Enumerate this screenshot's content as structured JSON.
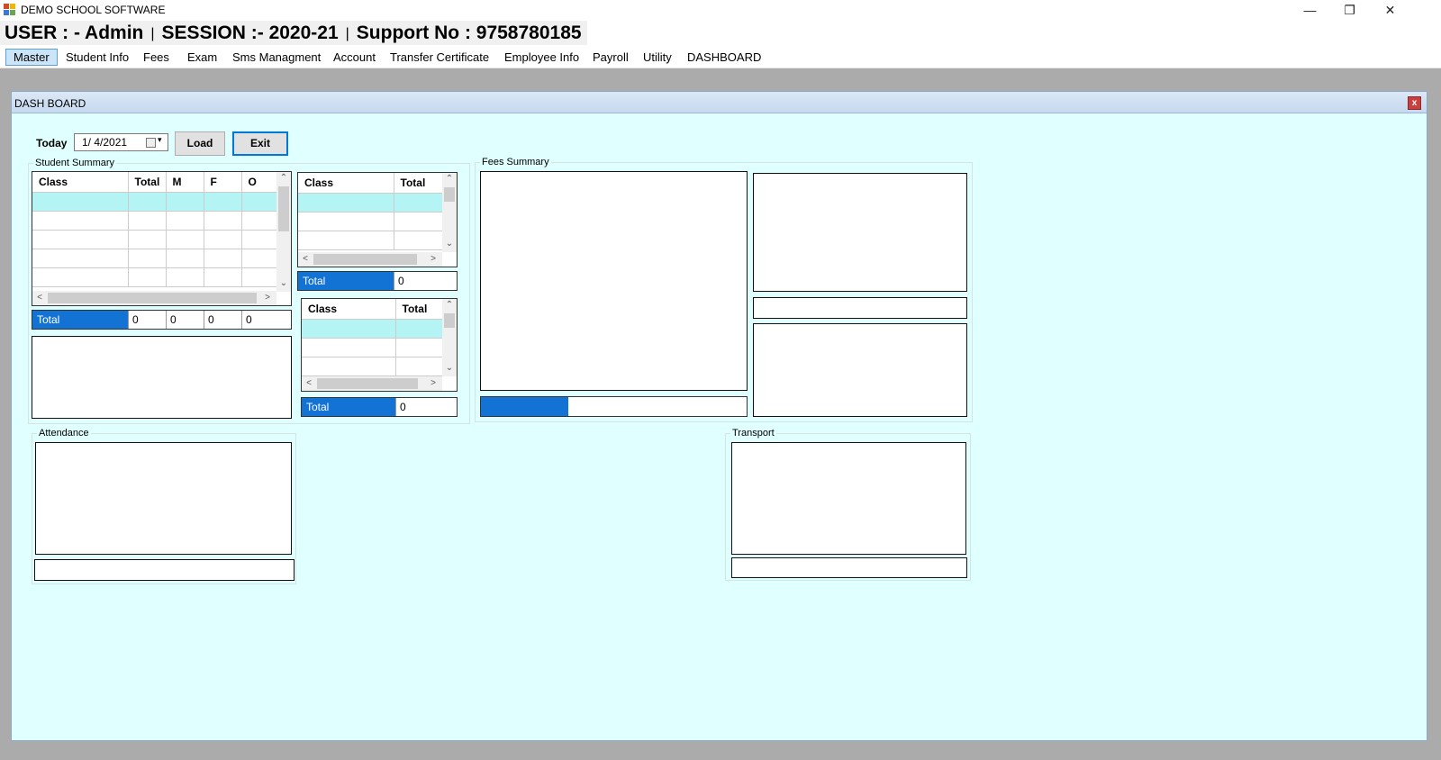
{
  "window": {
    "title": "DEMO SCHOOL SOFTWARE",
    "icon": "app-icon",
    "controls": [
      "minimize-icon",
      "restore-icon",
      "close-icon"
    ]
  },
  "header": {
    "user": "USER : - Admin",
    "session": "SESSION :- 2020-21",
    "support": "Support No : 9758780185"
  },
  "menu": [
    "Master",
    "Student Info",
    "Fees",
    "Exam",
    "Sms Managment",
    "Account",
    "Transfer Certificate",
    "Employee Info",
    "Payroll",
    "Utility",
    "DASHBOARD"
  ],
  "active_menu": "Master",
  "dashboard": {
    "title": "DASH BOARD",
    "close": "x",
    "today_label": "Today",
    "date_value": "1/  4/2021",
    "load_button": "Load",
    "exit_button": "Exit",
    "student_summary": {
      "title": "Student Summary",
      "columns": [
        "Class",
        "Total",
        "M",
        "F",
        "O"
      ],
      "total_label": "Total",
      "totals": [
        "0",
        "0",
        "0",
        "0"
      ]
    },
    "class_grid_1": {
      "columns": [
        "Class",
        "Total"
      ],
      "total_label": "Total",
      "total_value": "0"
    },
    "class_grid_2": {
      "columns": [
        "Class",
        "Total"
      ],
      "total_label": "Total",
      "total_value": "0"
    },
    "fees_summary": {
      "title": "Fees Summary",
      "progress": 0.33
    },
    "attendance": {
      "title": "Attendance"
    },
    "transport": {
      "title": "Transport"
    }
  },
  "colors": {
    "accent": "#1273d4",
    "panel_bg": "#e0ffff",
    "mdi_bg": "#ababab",
    "selected_row": "#b5f4f4"
  }
}
